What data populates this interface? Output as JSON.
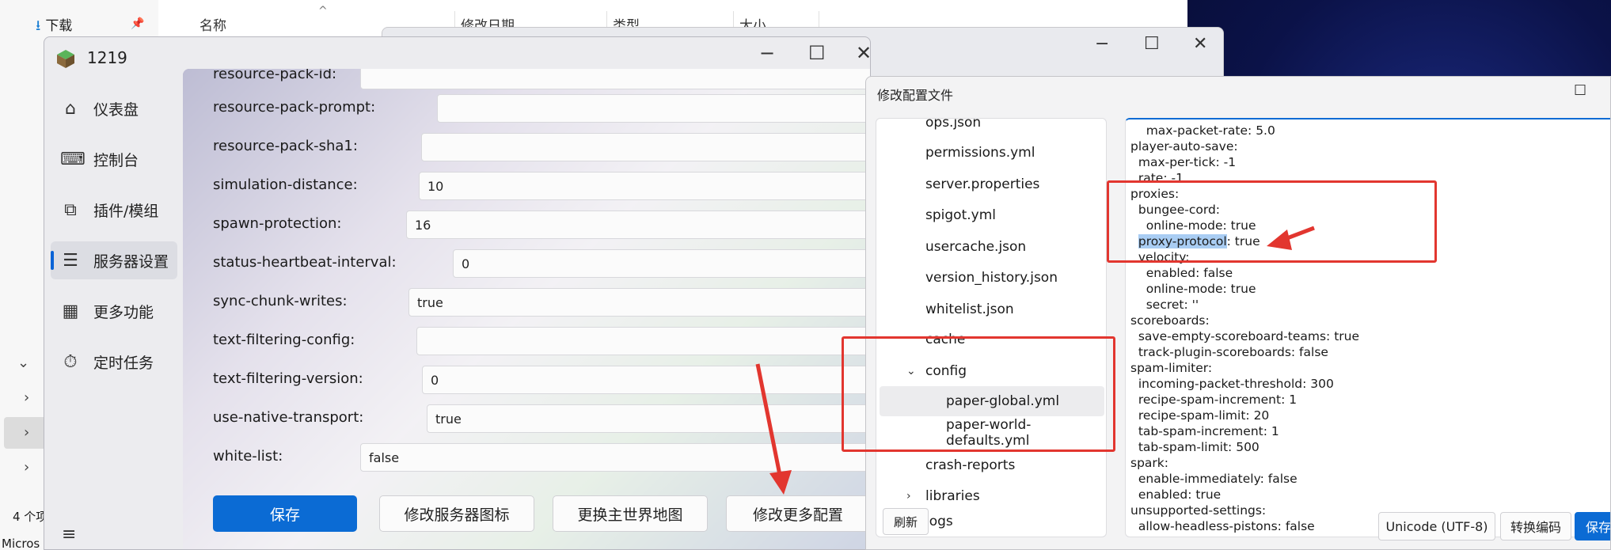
{
  "explorer": {
    "nav_downloads": "下载",
    "col_name": "名称",
    "col_modified": "修改日期",
    "col_type": "类型",
    "col_size": "大小",
    "item_count": "4 个项",
    "taskbar_text": "Micros"
  },
  "main_window": {
    "title": "1219",
    "sidebar": [
      {
        "label": "仪表盘",
        "icon": "home-icon"
      },
      {
        "label": "控制台",
        "icon": "terminal-icon"
      },
      {
        "label": "插件/模组",
        "icon": "plugin-icon"
      },
      {
        "label": "服务器设置",
        "icon": "settings-sliders-icon"
      },
      {
        "label": "更多功能",
        "icon": "grid-icon"
      },
      {
        "label": "定时任务",
        "icon": "timer-icon"
      }
    ],
    "properties": [
      {
        "label": "resource-pack-id:",
        "value": ""
      },
      {
        "label": "resource-pack-prompt:",
        "value": ""
      },
      {
        "label": "resource-pack-sha1:",
        "value": ""
      },
      {
        "label": "simulation-distance:",
        "value": "10"
      },
      {
        "label": "spawn-protection:",
        "value": "16"
      },
      {
        "label": "status-heartbeat-interval:",
        "value": "0"
      },
      {
        "label": "sync-chunk-writes:",
        "value": "true"
      },
      {
        "label": "text-filtering-config:",
        "value": ""
      },
      {
        "label": "text-filtering-version:",
        "value": "0"
      },
      {
        "label": "use-native-transport:",
        "value": "true"
      },
      {
        "label": "white-list:",
        "value": "false"
      }
    ],
    "buttons": {
      "save": "保存",
      "change_icon": "修改服务器图标",
      "change_world": "更换主世界地图",
      "more_config": "修改更多配置"
    }
  },
  "config_dialog": {
    "title": "修改配置文件",
    "tree": [
      {
        "label": "ops.json"
      },
      {
        "label": "permissions.yml"
      },
      {
        "label": "server.properties"
      },
      {
        "label": "spigot.yml"
      },
      {
        "label": "usercache.json"
      },
      {
        "label": "version_history.json"
      },
      {
        "label": "whitelist.json"
      },
      {
        "label": "cache"
      },
      {
        "label": "config",
        "arrow": "⌄"
      },
      {
        "label": "paper-global.yml"
      },
      {
        "label": "paper-world-defaults.yml"
      },
      {
        "label": "crash-reports"
      },
      {
        "label": "libraries",
        "arrow": "›"
      },
      {
        "label": "logs"
      }
    ],
    "refresh": "刷新",
    "code_lines": [
      "    max-packet-rate: 5.0",
      "player-auto-save:",
      "  max-per-tick: -1",
      "  rate: -1",
      "proxies:",
      "  bungee-cord:",
      "    online-mode: true",
      "  ",
      "  velocity:",
      "    enabled: false",
      "    online-mode: true",
      "    secret: ''",
      "scoreboards:",
      "  save-empty-scoreboard-teams: true",
      "  track-plugin-scoreboards: false",
      "spam-limiter:",
      "  incoming-packet-threshold: 300",
      "  recipe-spam-increment: 1",
      "  recipe-spam-limit: 20",
      "  tab-spam-increment: 1",
      "  tab-spam-limit: 500",
      "spark:",
      "  enable-immediately: false",
      "  enabled: true",
      "unsupported-settings:",
      "  allow-headless-pistons: false"
    ],
    "highlight_key": "proxy-protocol",
    "highlight_rest": ": true",
    "encoding": "Unicode (UTF-8)",
    "convert": "转换编码",
    "save": "保存"
  },
  "colors": {
    "accent": "#0b6bd4",
    "annotation_red": "#e2362f",
    "selection_highlight": "#a9cdf3"
  }
}
